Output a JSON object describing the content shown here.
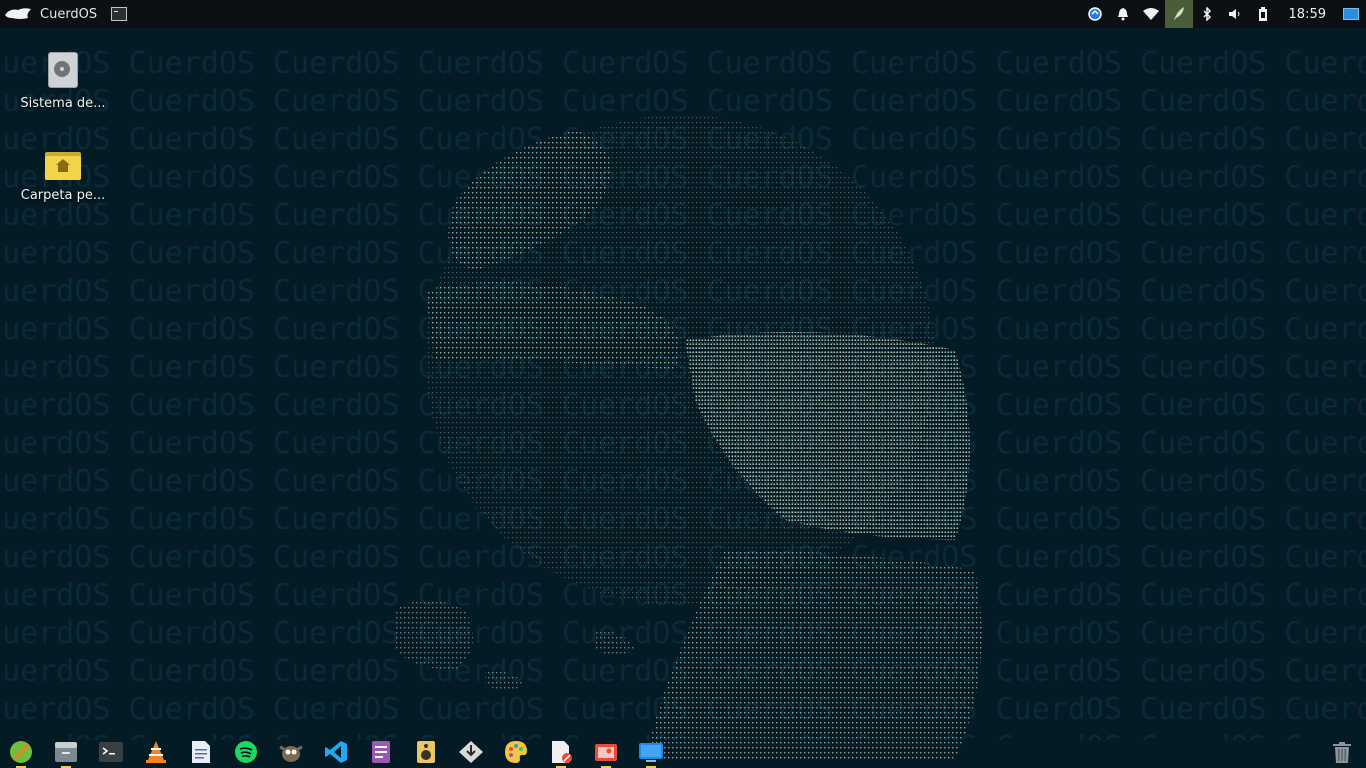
{
  "topbar": {
    "app_title": "CuerdOS",
    "clock": "18:59"
  },
  "watermark": {
    "text": "CuerdOS CuerdOS CuerdOS CuerdOS CuerdOS CuerdOS CuerdOS CuerdOS CuerdOS CuerdOS"
  },
  "desktop": {
    "icons": [
      {
        "label": "Sistema de...",
        "icon": "hard-disk-icon"
      },
      {
        "label": "Carpeta pe...",
        "icon": "home-folder-icon"
      }
    ]
  },
  "tray": {
    "icons": [
      "updates-icon",
      "notifications-bell-icon",
      "wifi-icon",
      "feather-app-icon",
      "bluetooth-icon",
      "volume-icon",
      "battery-icon"
    ]
  },
  "dock": {
    "apps": [
      {
        "name": "web-browser-icon"
      },
      {
        "name": "file-manager-icon"
      },
      {
        "name": "terminal-icon"
      },
      {
        "name": "vlc-icon"
      },
      {
        "name": "text-document-icon"
      },
      {
        "name": "spotify-icon"
      },
      {
        "name": "gimp-icon"
      },
      {
        "name": "vscode-icon"
      },
      {
        "name": "office-app-icon"
      },
      {
        "name": "audio-speaker-icon"
      },
      {
        "name": "install-system-icon"
      },
      {
        "name": "paint-palette-icon"
      },
      {
        "name": "notes-edit-icon"
      },
      {
        "name": "screenshot-icon"
      },
      {
        "name": "display-settings-icon"
      }
    ],
    "trash": "trash-icon"
  }
}
